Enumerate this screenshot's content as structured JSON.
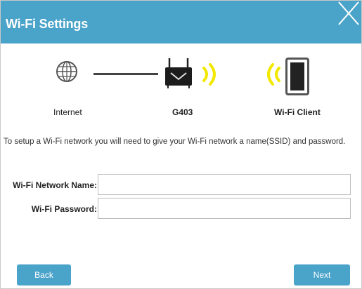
{
  "window": {
    "title": "Wi-Fi Settings"
  },
  "diagram": {
    "internet_label": "Internet",
    "router_label": "G403",
    "client_label": "Wi-Fi Client"
  },
  "description": "To setup a Wi-Fi network you will need to give your Wi-Fi network a name(SSID) and password.",
  "form": {
    "network_name_label": "Wi-Fi Network Name:",
    "network_name_value": "",
    "password_label": "Wi-Fi Password:",
    "password_value": ""
  },
  "buttons": {
    "back_label": "Back",
    "next_label": "Next"
  },
  "colors": {
    "accent": "#4aa3c9",
    "wave": "#f2e800"
  },
  "icons": [
    "close-icon",
    "globe-icon",
    "router-icon",
    "wifi-wave-icon",
    "tablet-icon"
  ]
}
